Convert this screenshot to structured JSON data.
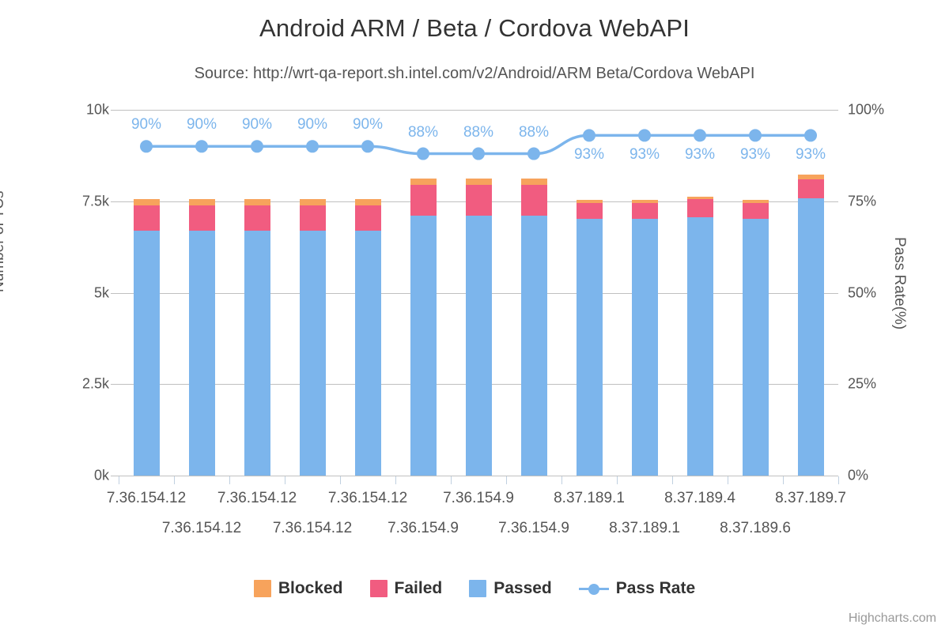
{
  "title": "Android ARM / Beta / Cordova WebAPI",
  "subtitle": "Source: http://wrt-qa-report.sh.intel.com/v2/Android/ARM Beta/Cordova WebAPI",
  "credits": "Highcharts.com",
  "colors": {
    "blocked": "#f7a35c",
    "failed": "#f15c80",
    "passed": "#7cb5ec",
    "passrate": "#7cb5ec",
    "gridline": "#c0c0c0",
    "text": "#555555"
  },
  "legend": {
    "items": [
      {
        "label": "Blocked",
        "type": "swatch",
        "color": "#f7a35c"
      },
      {
        "label": "Failed",
        "type": "swatch",
        "color": "#f15c80"
      },
      {
        "label": "Passed",
        "type": "swatch",
        "color": "#7cb5ec"
      },
      {
        "label": "Pass Rate",
        "type": "line",
        "color": "#7cb5ec"
      }
    ]
  },
  "chart_data": {
    "type": "bar",
    "title": "Android ARM / Beta / Cordova WebAPI",
    "subtitle": "Source: http://wrt-qa-report.sh.intel.com/v2/Android/ARM Beta/Cordova WebAPI",
    "xlabel": "",
    "ylabel": "Number of TCs",
    "y2label": "Pass Rate(%)",
    "stacked": true,
    "grid": true,
    "legend_position": "bottom",
    "categories": [
      "7.36.154.12",
      "7.36.154.12",
      "7.36.154.12",
      "7.36.154.12",
      "7.36.154.12",
      "7.36.154.9",
      "7.36.154.9",
      "7.36.154.9",
      "8.37.189.1",
      "8.37.189.1",
      "8.37.189.4",
      "8.37.189.6",
      "8.37.189.7"
    ],
    "ylim": [
      0,
      10000
    ],
    "yticks": [
      0,
      2500,
      5000,
      7500,
      10000
    ],
    "ytick_labels": [
      "0k",
      "2.5k",
      "5k",
      "7.5k",
      "10k"
    ],
    "y2lim": [
      0,
      100
    ],
    "y2ticks": [
      0,
      25,
      50,
      75,
      100
    ],
    "y2tick_labels": [
      "0%",
      "25%",
      "50%",
      "75%",
      "100%"
    ],
    "series": [
      {
        "name": "Passed",
        "type": "bar",
        "color": "#7cb5ec",
        "values": [
          6690,
          6690,
          6690,
          6690,
          6690,
          7110,
          7110,
          7110,
          7010,
          7010,
          7060,
          7010,
          7590
        ]
      },
      {
        "name": "Failed",
        "type": "bar",
        "color": "#f15c80",
        "values": [
          700,
          700,
          700,
          700,
          700,
          840,
          840,
          840,
          440,
          440,
          490,
          440,
          520
        ]
      },
      {
        "name": "Blocked",
        "type": "bar",
        "color": "#f7a35c",
        "values": [
          180,
          180,
          180,
          180,
          180,
          180,
          180,
          180,
          80,
          80,
          80,
          80,
          110
        ]
      },
      {
        "name": "Pass Rate",
        "type": "line",
        "color": "#7cb5ec",
        "axis": "y2",
        "values": [
          90,
          90,
          90,
          90,
          90,
          88,
          88,
          88,
          93,
          93,
          93,
          93,
          93
        ],
        "data_labels": [
          "90%",
          "90%",
          "90%",
          "90%",
          "90%",
          "88%",
          "88%",
          "88%",
          "93%",
          "93%",
          "93%",
          "93%",
          "93%"
        ],
        "data_label_position": [
          "above",
          "above",
          "above",
          "above",
          "above",
          "above",
          "above",
          "above",
          "below",
          "below",
          "below",
          "below",
          "below"
        ]
      }
    ]
  }
}
